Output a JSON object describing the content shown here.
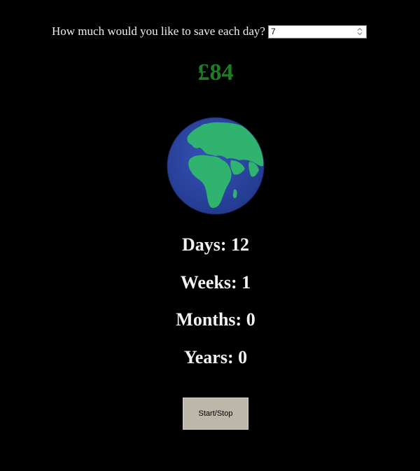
{
  "savings_form": {
    "question": "How much would you like to save each day?",
    "amount_value": "7"
  },
  "total": {
    "amount": "£84",
    "color": "#1e7d22"
  },
  "globe": {
    "icon": "earth-globe-icon",
    "ocean_color": "#2a44a0",
    "land_color": "#2fb36e"
  },
  "stats": {
    "days": "Days: 12",
    "weeks": "Weeks: 1",
    "months": "Months: 0",
    "years": "Years: 0"
  },
  "controls": {
    "start_stop_label": "Start/Stop"
  }
}
